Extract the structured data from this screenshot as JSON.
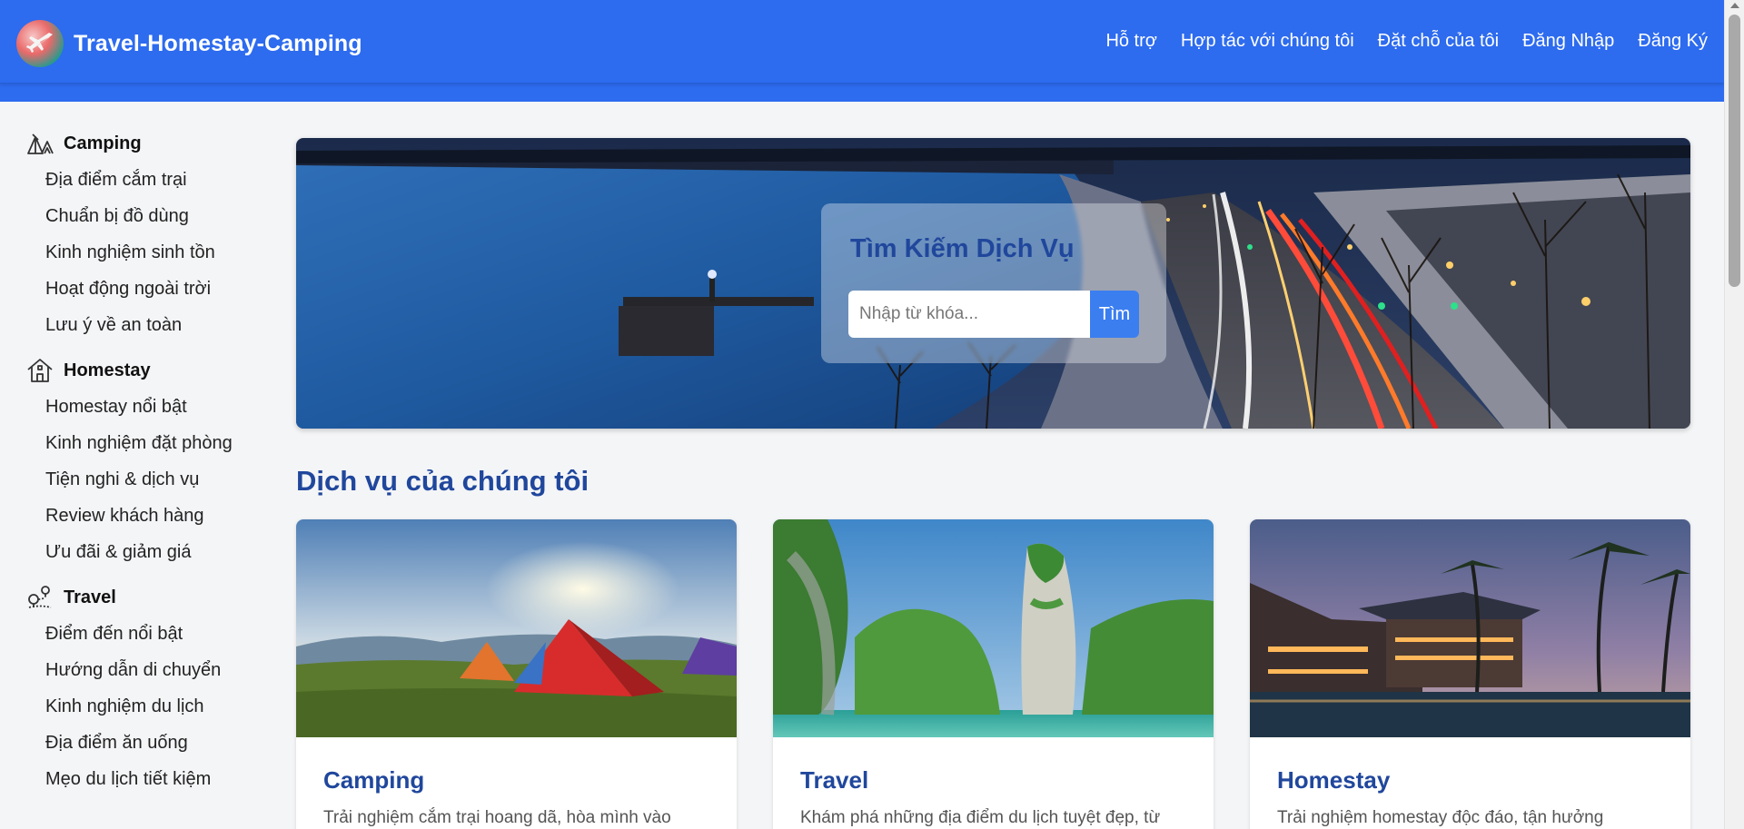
{
  "header": {
    "brand": "Travel-Homestay-Camping",
    "nav": [
      {
        "label": "Hỗ trợ"
      },
      {
        "label": "Hợp tác với chúng tôi"
      },
      {
        "label": "Đặt chỗ của tôi"
      },
      {
        "label": "Đăng Nhập"
      },
      {
        "label": "Đăng Ký"
      }
    ]
  },
  "sidebar": {
    "sections": [
      {
        "title": "Camping",
        "icon": "camping-icon",
        "items": [
          "Địa điểm cắm trại",
          "Chuẩn bị đồ dùng",
          "Kinh nghiệm sinh tồn",
          "Hoạt động ngoài trời",
          "Lưu ý về an toàn"
        ]
      },
      {
        "title": "Homestay",
        "icon": "house-icon",
        "items": [
          "Homestay nổi bật",
          "Kinh nghiệm đặt phòng",
          "Tiện nghi & dịch vụ",
          "Review khách hàng",
          "Ưu đãi & giảm giá"
        ]
      },
      {
        "title": "Travel",
        "icon": "map-pin-icon",
        "items": [
          "Điểm đến nổi bật",
          "Hướng dẫn di chuyển",
          "Kinh nghiệm du lịch",
          "Địa điểm ăn uống",
          "Mẹo du lịch tiết kiệm"
        ]
      }
    ]
  },
  "hero": {
    "search_title": "Tìm Kiếm Dịch Vụ",
    "search_placeholder": "Nhập từ khóa...",
    "search_button": "Tìm"
  },
  "services": {
    "title": "Dịch vụ của chúng tôi",
    "cards": [
      {
        "title": "Camping",
        "desc": "Trải nghiệm cắm trại hoang dã, hòa mình vào"
      },
      {
        "title": "Travel",
        "desc": "Khám phá những địa điểm du lịch tuyệt đẹp, từ"
      },
      {
        "title": "Homestay",
        "desc": "Trải nghiệm homestay độc đáo, tận hưởng"
      }
    ]
  },
  "colors": {
    "header_bg": "#2d6bef",
    "accent_title": "#20479c",
    "button": "#3b7ef0"
  }
}
